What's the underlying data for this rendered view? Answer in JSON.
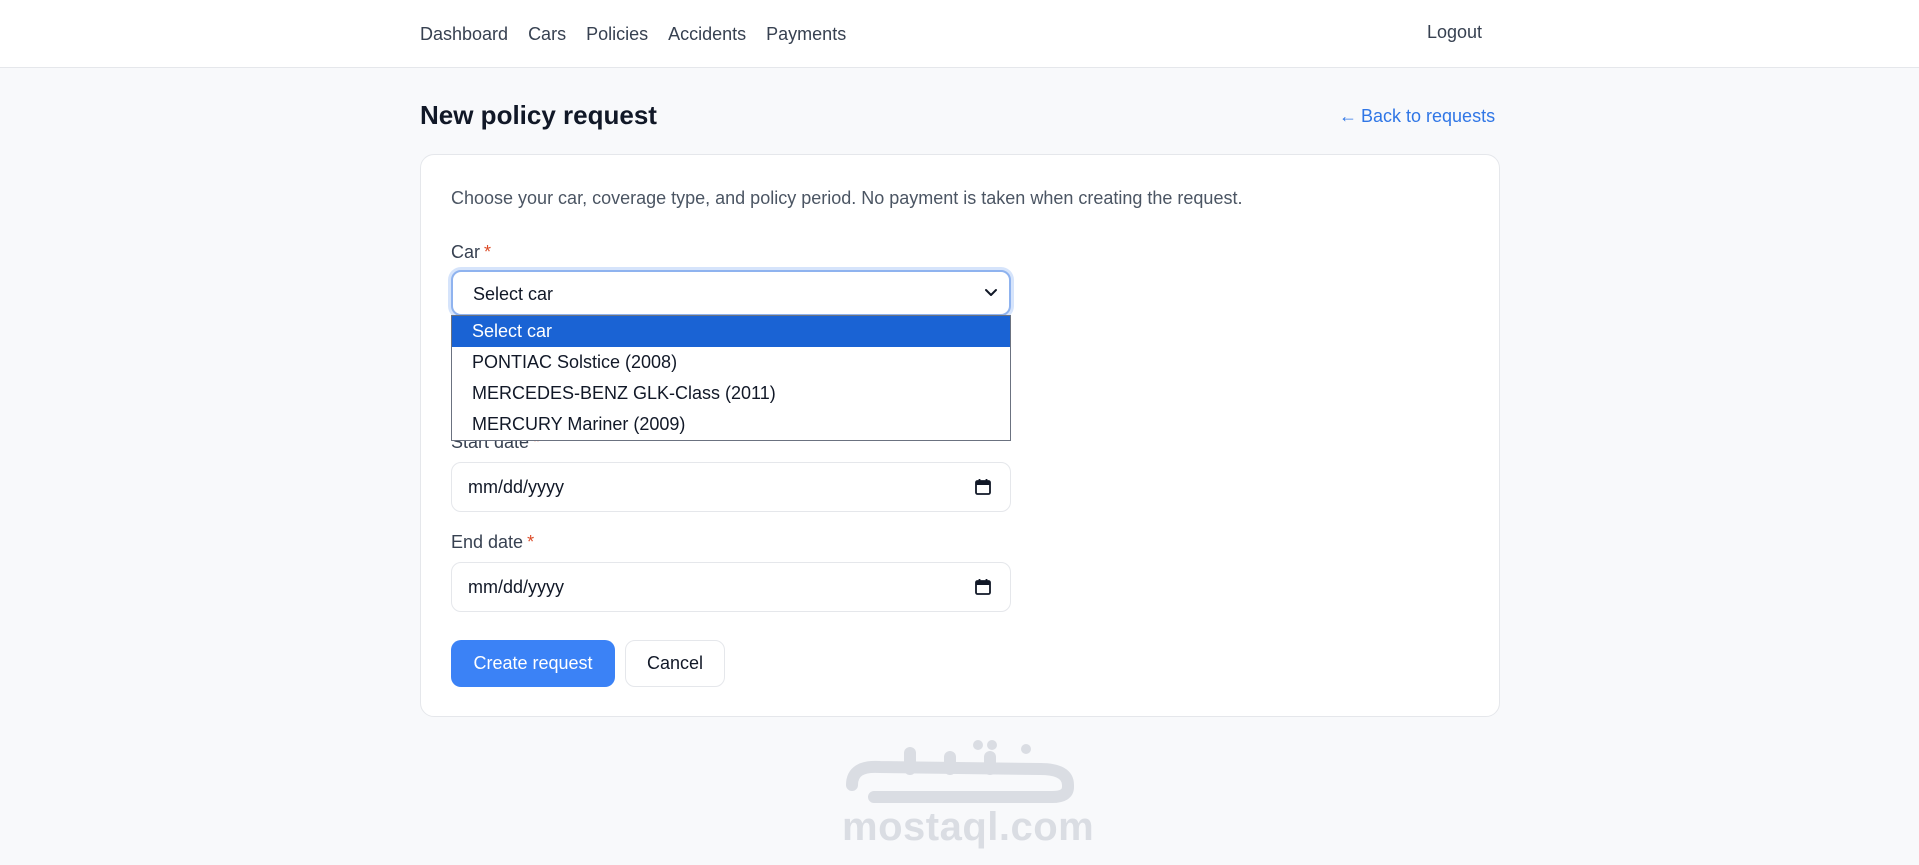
{
  "nav": {
    "items": [
      {
        "label": "Dashboard"
      },
      {
        "label": "Cars"
      },
      {
        "label": "Policies"
      },
      {
        "label": "Accidents"
      },
      {
        "label": "Payments"
      }
    ],
    "logout": "Logout"
  },
  "page": {
    "title": "New policy request",
    "back_link": "Back to requests",
    "back_icon": "arrow-left-icon"
  },
  "form": {
    "intro": "Choose your car, coverage type, and policy period. No payment is taken when creating the request.",
    "required_mark": "*",
    "car": {
      "label": "Car",
      "value": "Select car",
      "options": [
        "Select car",
        "PONTIAC Solstice (2008)",
        "MERCEDES-BENZ GLK-Class (2011)",
        "MERCURY Mariner (2009)"
      ]
    },
    "start_date": {
      "label": "Start date",
      "placeholder": "mm/dd/yyyy"
    },
    "end_date": {
      "label": "End date",
      "placeholder": "mm/dd/yyyy"
    },
    "submit_label": "Create request",
    "cancel_label": "Cancel"
  },
  "colors": {
    "accent": "#3b82f6",
    "link": "#2f76e6",
    "required": "#dc4a26",
    "dropdown_highlight": "#1a63d4"
  },
  "watermark": {
    "latin": "mostaql.com",
    "arabic": "مستقل"
  }
}
